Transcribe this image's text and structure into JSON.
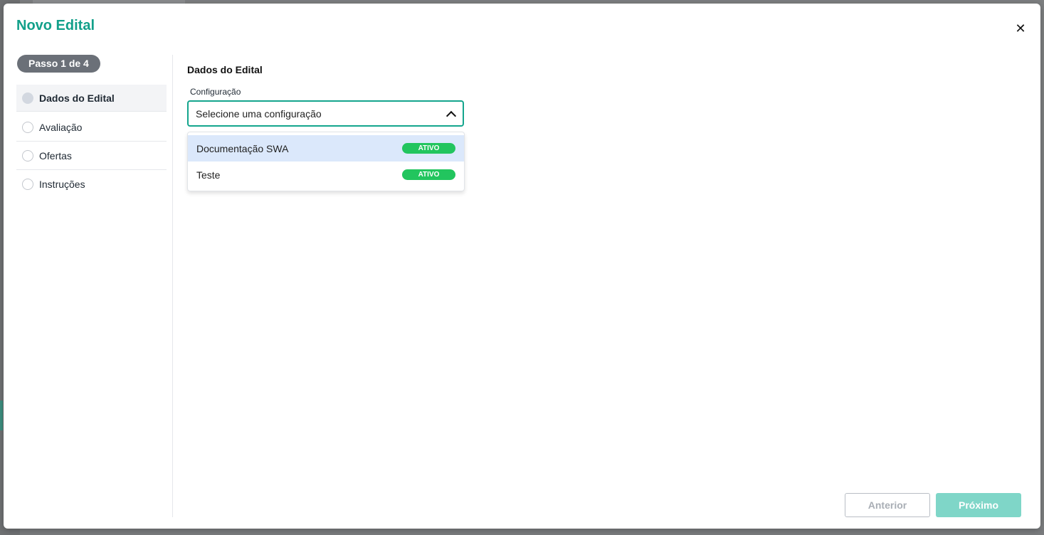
{
  "modal": {
    "title": "Novo Edital",
    "close_symbol": "✕"
  },
  "sidebar": {
    "step_badge": "Passo 1 de 4",
    "steps": [
      {
        "label": "Dados do Edital",
        "active": true
      },
      {
        "label": "Avaliação",
        "active": false
      },
      {
        "label": "Ofertas",
        "active": false
      },
      {
        "label": "Instruções",
        "active": false
      }
    ]
  },
  "content": {
    "section_title": "Dados do Edital",
    "field_label": "Configuração",
    "select_placeholder": "Selecione uma configuração",
    "options": [
      {
        "label": "Documentação SWA",
        "status": "ATIVO",
        "highlighted": true
      },
      {
        "label": "Teste",
        "status": "ATIVO",
        "highlighted": false
      }
    ]
  },
  "footer": {
    "prev_label": "Anterior",
    "next_label": "Próximo"
  },
  "colors": {
    "accent": "#12a08a",
    "badge_active": "#22c55e",
    "next_button": "#7fd6c8"
  }
}
